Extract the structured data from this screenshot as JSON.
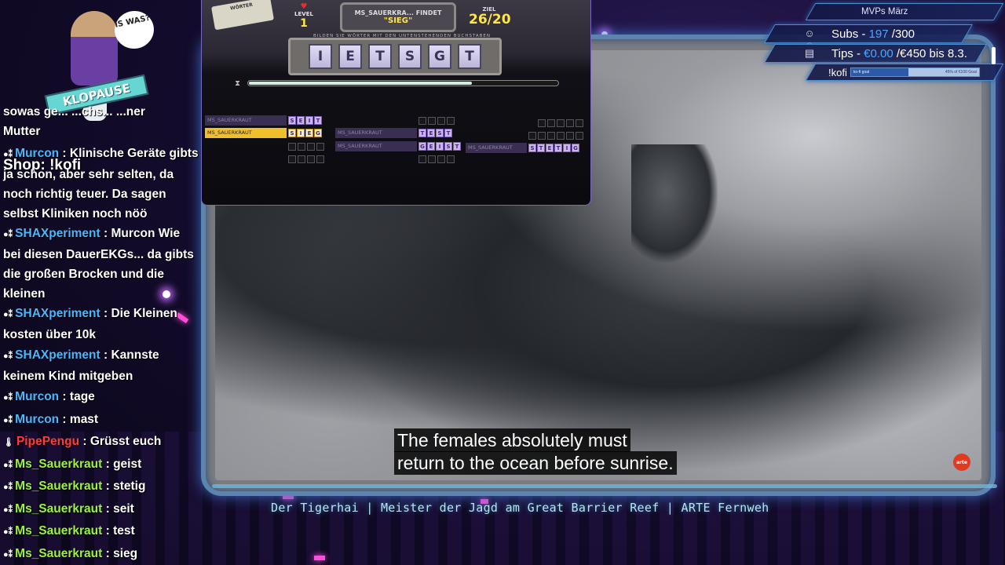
{
  "video": {
    "subtitle_line1": "The females absolutely must",
    "subtitle_line2": "return to the ocean before sunrise.",
    "channel_logo": "arte",
    "stream_title": "Der Tigerhai | Meister der Jagd am Great Barrier Reef | ARTE Fernweh"
  },
  "game": {
    "logo_text": "WÖRTER",
    "level_label": "LEVEL",
    "level_value": "1",
    "found_text": "MS_SAUERKRA...  FINDET",
    "found_word": "\"SIEG\"",
    "goal_label": "ZIEL",
    "goal_value": "26/20",
    "hint": "BILDEN SIE WÖRTER MIT DEN UNTENSTEHENDEN BUCHSTABEN",
    "letters": [
      "I",
      "E",
      "T",
      "S",
      "G",
      "T"
    ],
    "timer_fraction": 0.72,
    "timer_icon": "hourglass-icon",
    "found_words": [
      {
        "owner": "MS_SAUERKRAUT",
        "letters": [
          "S",
          "E",
          "I",
          "T"
        ],
        "highlight": false
      },
      {
        "owner": "MS_SAUERKRAUT",
        "letters": [
          "S",
          "I",
          "E",
          "G"
        ],
        "highlight": true
      },
      {
        "owner": "MS_SAUERKRAUT",
        "letters": [
          "T",
          "E",
          "S",
          "T"
        ],
        "highlight": false
      },
      {
        "owner": "MS_SAUERKRAUT",
        "letters": [
          "G",
          "E",
          "I",
          "S",
          "T"
        ],
        "highlight": false
      },
      {
        "owner": "MS_SAUERKRAUT",
        "letters": [
          "S",
          "T",
          "E",
          "T",
          "I",
          "G"
        ],
        "highlight": false
      }
    ]
  },
  "overlay": {
    "bubble_text": "IS WAS?",
    "banner_text": "KLOPAUSE",
    "shop_text": "Shop: !kofi"
  },
  "chat": [
    {
      "user": "",
      "message": "sowas ge... ...chs... ...ner",
      "color": "none"
    },
    {
      "user": "",
      "message": "Mutter",
      "color": "none"
    },
    {
      "user": "Murcon",
      "message": "Klinische Geräte gibts ja schon, aber sehr selten, da noch richtig teuer. Da sagen selbst Kliniken noch nöö",
      "color": "cyan"
    },
    {
      "user": "SHAXperiment",
      "message": "Murcon Wie bei diesen DauerEKGs... da gibts die großen Brocken und die kleinen",
      "color": "cyan"
    },
    {
      "user": "SHAXperiment",
      "message": "Die Kleinen kosten über 10k",
      "color": "cyan"
    },
    {
      "user": "SHAXperiment",
      "message": "Kannste keinem Kind mitgeben",
      "color": "cyan"
    },
    {
      "user": "Murcon",
      "message": "tage",
      "color": "cyan"
    },
    {
      "user": "Murcon",
      "message": "mast",
      "color": "cyan"
    },
    {
      "user": "PipePengu",
      "message": "Grüsst euch",
      "color": "red"
    },
    {
      "user": "Ms_Sauerkraut",
      "message": "geist",
      "color": "green"
    },
    {
      "user": "Ms_Sauerkraut",
      "message": "stetig",
      "color": "green"
    },
    {
      "user": "Ms_Sauerkraut",
      "message": "seit",
      "color": "green"
    },
    {
      "user": "Ms_Sauerkraut",
      "message": "test",
      "color": "green"
    },
    {
      "user": "Ms_Sauerkraut",
      "message": "sieg",
      "color": "green"
    }
  ],
  "mvp": {
    "title": "MVPs März",
    "subs_label": "Subs -",
    "subs_current": "197",
    "subs_goal": "/300",
    "tips_label": "Tips -",
    "tips_current": "€0.00",
    "tips_goal": "/€450 bis 8.3.",
    "kofi_label": "!kofi",
    "kofi_bar_left": "ko-fi goal",
    "kofi_bar_right": "45% of €100 Goal",
    "kofi_fraction": 0.45,
    "icons": [
      "users-icon",
      "coins-icon"
    ]
  },
  "colors": {
    "accent_blue": "#48b8ff",
    "accent_green": "#9cf23a",
    "highlight_yellow": "#f0c02c",
    "frame_blue": "#5d84ae"
  }
}
